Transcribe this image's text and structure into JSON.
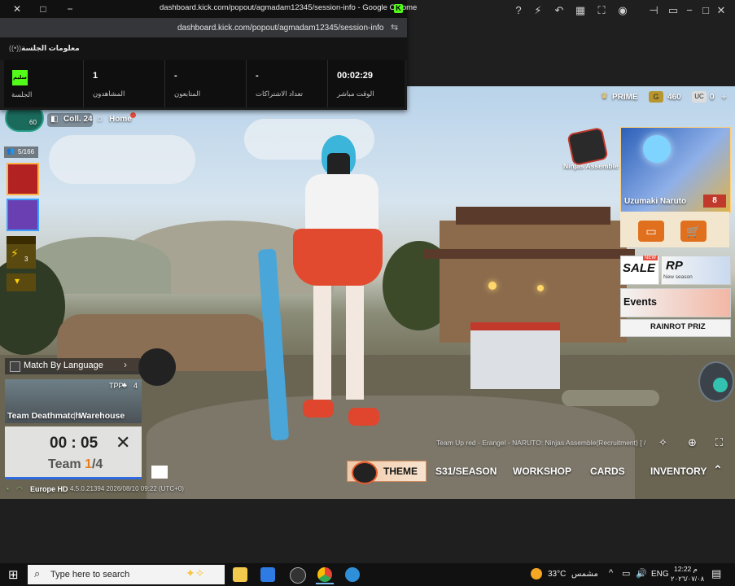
{
  "popout": {
    "title": "dashboard.kick.com/popout/agmadam12345/session-info - Google Chrome",
    "url": "dashboard.kick.com/popout/agmadam12345/session-info",
    "panel_title": "معلومات الجلسة",
    "stats": [
      {
        "value": "00:02:29",
        "label": "الوقت مباشر"
      },
      {
        "value": "-",
        "label": "تعداد الاشتراكات"
      },
      {
        "value": "-",
        "label": "المتابعون"
      },
      {
        "value": "1",
        "label": "المشاهدون"
      }
    ],
    "session": {
      "badge": "سليم",
      "label": "الجلسة"
    }
  },
  "game": {
    "currency_prime": "PRIME",
    "currency_g": "460",
    "currency_uc": "0",
    "coll_label": "Coll. 24",
    "home_label": "Home",
    "level": "60",
    "players": "5/166",
    "energy": "3",
    "ninjas_label": "Ninjas Assemble",
    "naruto_name": "Uzumaki Naruto",
    "naruto_count": "8",
    "sale_label": "SALE",
    "new_label": "NEW",
    "rp_label": "RP",
    "rp_sub": "New season",
    "events_label": "Events",
    "rainrot_label": "RAINROT PRIZ",
    "match_language": "Match By Language",
    "tpp_label": "TPP",
    "tpp_count": "4",
    "mode_label": "Team Deathmatch",
    "map_label": "Warehouse",
    "timer": "00 : 05",
    "team_prefix": "Team ",
    "team_count": "1",
    "team_suffix": "/4",
    "server_info": "Europe  HD",
    "version_info": "4.5.0.21394 2026/08/10 09:22 (UTC+0)",
    "team_up_text": "Team Up  red - Erangel - NARUTO: Ninjas Assemble(Recruitment) [ /",
    "nav": [
      "THEME",
      "S31/SEASON",
      "WORKSHOP",
      "CARDS",
      "INVENTORY"
    ]
  },
  "taskbar": {
    "search_placeholder": "Type here to search",
    "temperature": "33°C",
    "weather": "مشمس",
    "language": "ENG",
    "time": "12:22 م",
    "date": "٢٠٢٦/٠٧/٠٨"
  }
}
